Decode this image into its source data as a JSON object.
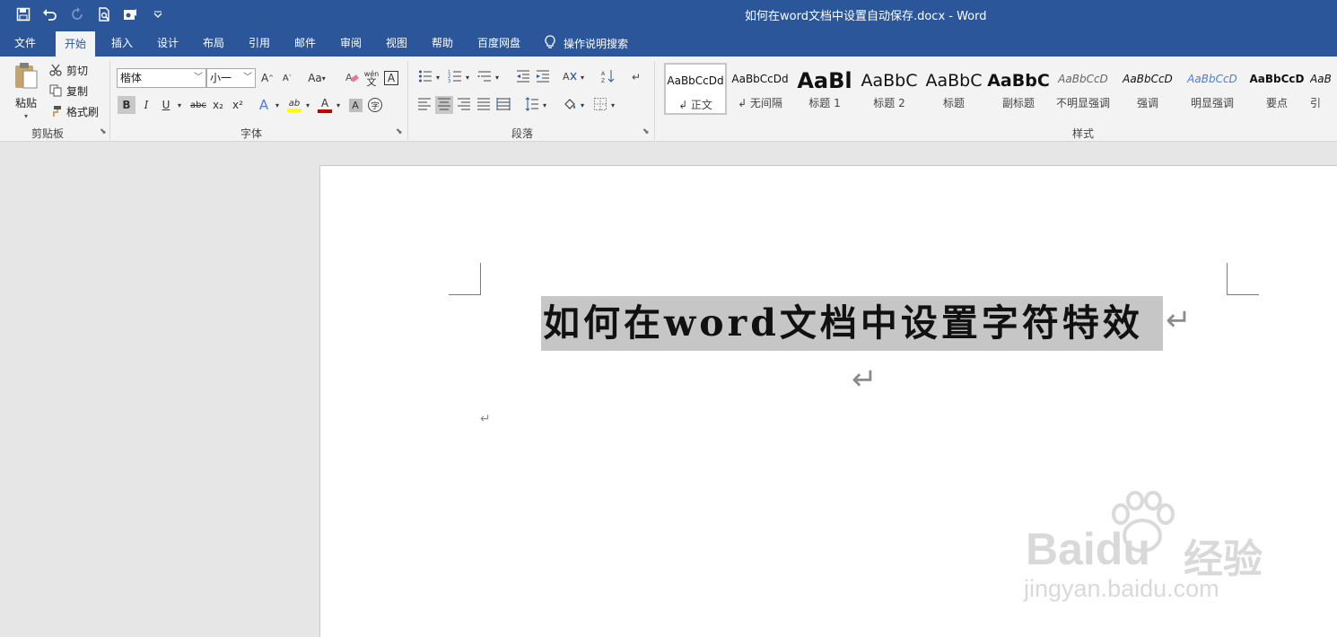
{
  "window": {
    "title": "如何在word文档中设置自动保存.docx  -  Word"
  },
  "quick_access": [
    "save-icon",
    "undo-icon",
    "redo-icon",
    "print-preview-icon",
    "touch-mode-icon",
    "customize-icon"
  ],
  "tabs": [
    "文件",
    "开始",
    "插入",
    "设计",
    "布局",
    "引用",
    "邮件",
    "审阅",
    "视图",
    "帮助",
    "百度网盘"
  ],
  "active_tab": "开始",
  "tell_me": "操作说明搜索",
  "clipboard": {
    "label": "剪贴板",
    "paste": "粘贴",
    "cut": "剪切",
    "copy": "复制",
    "format_painter": "格式刷"
  },
  "font": {
    "label": "字体",
    "name": "楷体",
    "size": "小一",
    "grow": "A",
    "shrink": "A",
    "change_case": "Aa",
    "clear": "A",
    "phonetic": "wén",
    "border_char": "A",
    "bold": "B",
    "italic": "I",
    "underline": "U",
    "strike": "abc",
    "sub": "x₂",
    "sup": "x²",
    "effects": "A",
    "highlight": "ab",
    "font_color": "A",
    "shading": "A",
    "enclose": "字"
  },
  "paragraph": {
    "label": "段落"
  },
  "styles": {
    "label": "样式",
    "items": [
      {
        "preview": "AaBbCcDd",
        "name": "↲ 正文"
      },
      {
        "preview": "AaBbCcDd",
        "name": "↲ 无间隔"
      },
      {
        "preview": "AaBl",
        "name": "标题 1"
      },
      {
        "preview": "AaBbC",
        "name": "标题 2"
      },
      {
        "preview": "AaBbC",
        "name": "标题"
      },
      {
        "preview": "AaBbC",
        "name": "副标题"
      },
      {
        "preview": "AaBbCcD",
        "name": "不明显强调"
      },
      {
        "preview": "AaBbCcD",
        "name": "强调"
      },
      {
        "preview": "AaBbCcD",
        "name": "明显强调"
      },
      {
        "preview": "AaBbCcD",
        "name": "要点"
      },
      {
        "preview": "AaB",
        "name": "引"
      }
    ]
  },
  "document": {
    "heading": "如何在word文档中设置字符特效",
    "paragraph_mark": "↵"
  },
  "watermark": {
    "brand": "Baidu",
    "brand_cn": "经验",
    "url": "jingyan.baidu.com"
  },
  "colors": {
    "accent": "#2b579a",
    "selection": "#c6c6c6",
    "highlight": "#ffff00",
    "font_red": "#c00000"
  }
}
